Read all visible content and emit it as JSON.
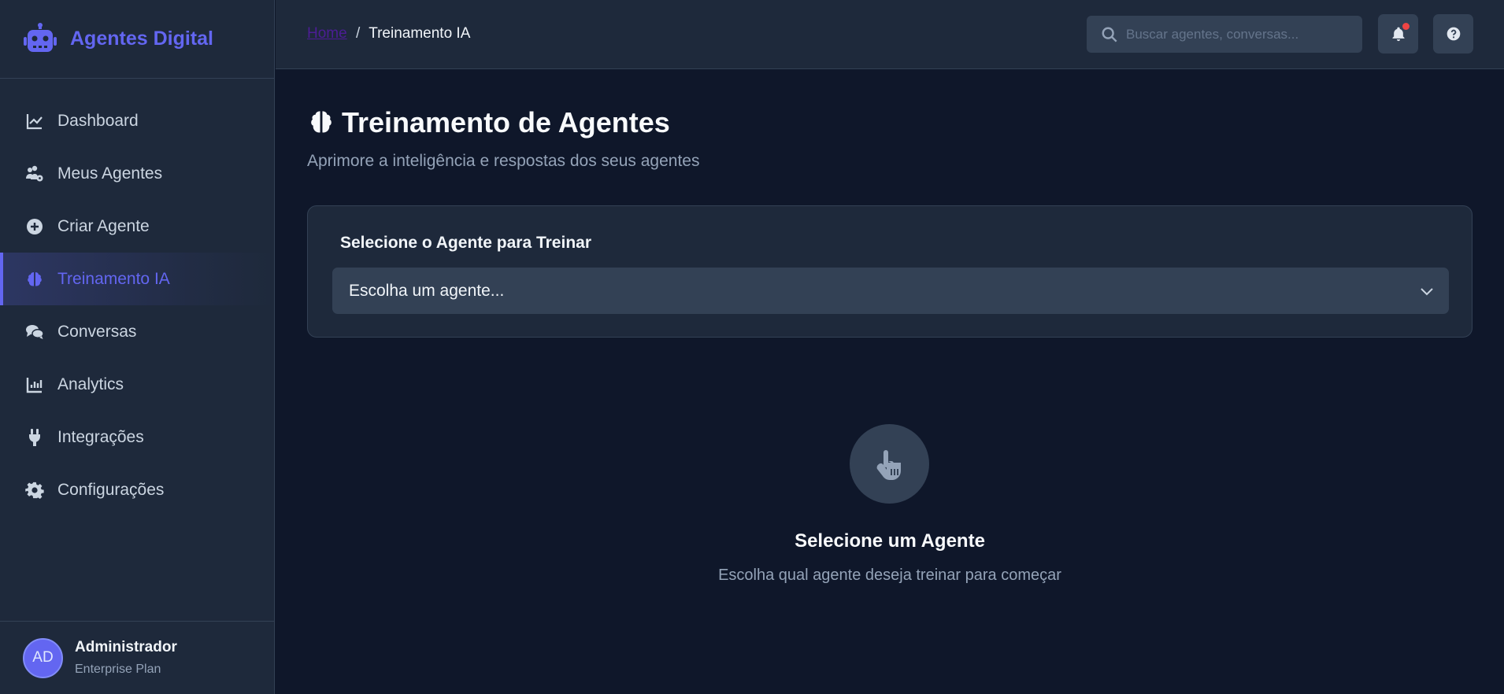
{
  "brand": {
    "name": "Agentes Digital",
    "icon": "robot-icon",
    "accent": "#6366f1"
  },
  "sidebar": {
    "items": [
      {
        "label": "Dashboard",
        "icon": "chart-line-icon"
      },
      {
        "label": "Meus Agentes",
        "icon": "users-cog-icon"
      },
      {
        "label": "Criar Agente",
        "icon": "plus-circle-icon"
      },
      {
        "label": "Treinamento IA",
        "icon": "brain-icon",
        "active": true
      },
      {
        "label": "Conversas",
        "icon": "comments-icon"
      },
      {
        "label": "Analytics",
        "icon": "chart-bar-icon"
      },
      {
        "label": "Integrações",
        "icon": "plug-icon"
      },
      {
        "label": "Configurações",
        "icon": "gear-icon"
      }
    ]
  },
  "user": {
    "initials": "AD",
    "name": "Administrador",
    "plan": "Enterprise Plan"
  },
  "header": {
    "breadcrumb": {
      "home": "Home",
      "separator": "/",
      "current": "Treinamento IA"
    },
    "search": {
      "placeholder": "Buscar agentes, conversas..."
    },
    "notification_badge_color": "#ef4444"
  },
  "main": {
    "title": "Treinamento de Agentes",
    "title_icon": "brain-icon",
    "subtitle": "Aprimore a inteligência e respostas dos seus agentes",
    "selector": {
      "label": "Selecione o Agente para Treinar",
      "value": "Escolha um agente..."
    },
    "empty_state": {
      "icon": "hand-pointer-icon",
      "title": "Selecione um Agente",
      "text": "Escolha qual agente deseja treinar para começar"
    }
  }
}
